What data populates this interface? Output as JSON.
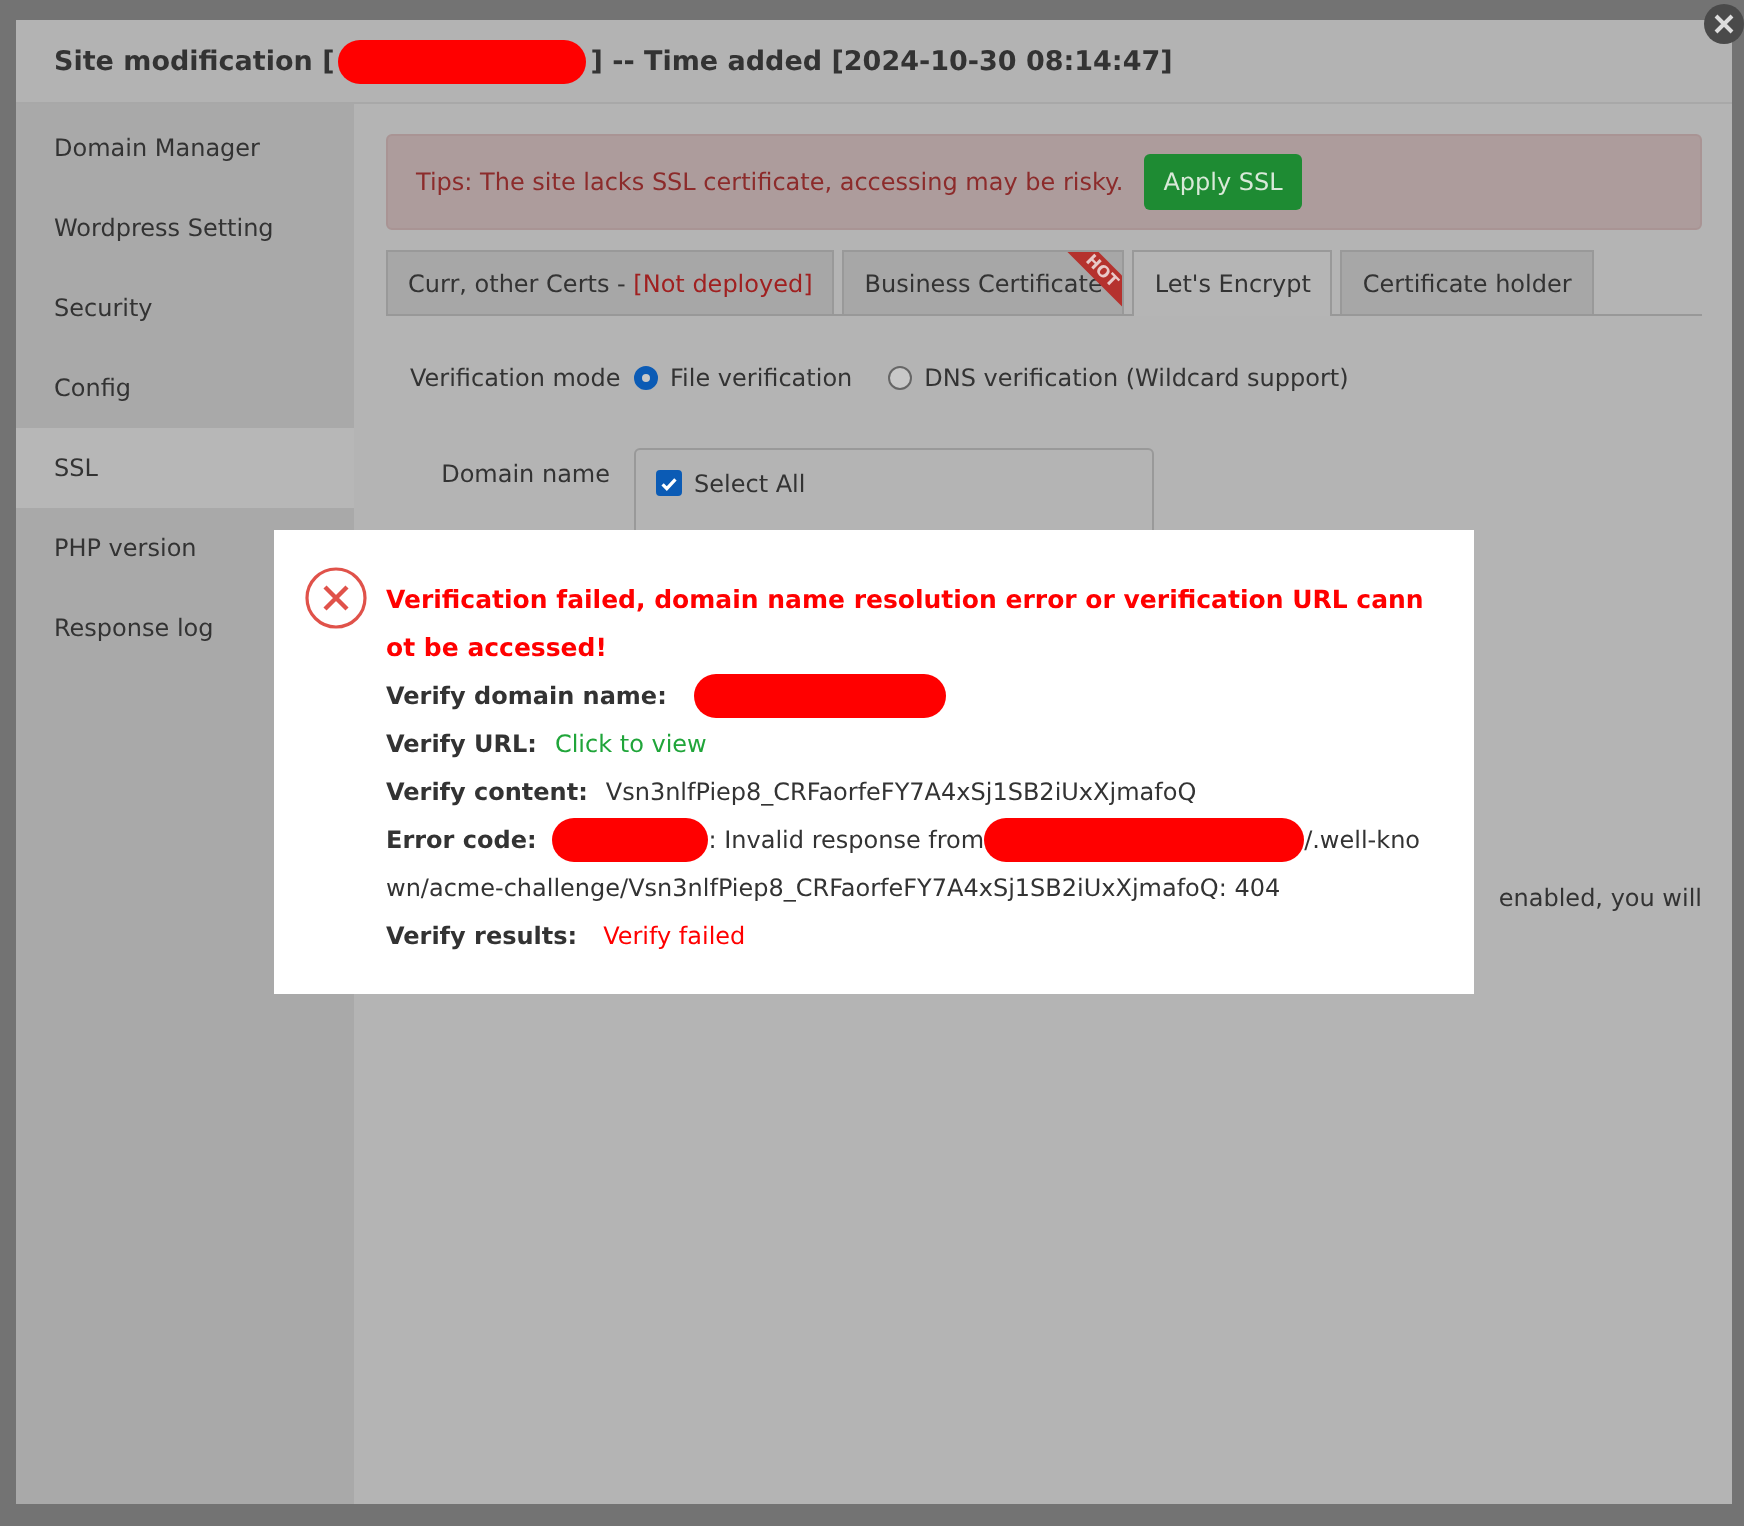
{
  "dialog": {
    "title_prefix": "Site modification [",
    "title_suffix": "] -- Time added [2024-10-30 08:14:47]"
  },
  "sidebar": {
    "items": [
      {
        "label": "Domain Manager",
        "selected": false
      },
      {
        "label": "Wordpress Setting",
        "selected": false
      },
      {
        "label": "Security",
        "selected": false
      },
      {
        "label": "Config",
        "selected": false
      },
      {
        "label": "SSL",
        "selected": true
      },
      {
        "label": "PHP version",
        "selected": false
      },
      {
        "label": "Response log",
        "selected": false
      }
    ]
  },
  "tip": {
    "text": "Tips: The site lacks SSL certificate, accessing may be risky.",
    "button": "Apply SSL"
  },
  "tabs": [
    {
      "label": "Curr, other Certs - ",
      "status": "[Not deployed]",
      "selected": false
    },
    {
      "label": "Business Certificate",
      "badge": "HOT",
      "selected": false
    },
    {
      "label": "Let's Encrypt",
      "selected": true
    },
    {
      "label": "Certificate holder",
      "selected": false
    }
  ],
  "verification_mode": {
    "label": "Verification mode",
    "options": [
      {
        "label": "File verification",
        "selected": true
      },
      {
        "label": "DNS verification (Wildcard support)",
        "selected": false
      }
    ]
  },
  "domain": {
    "label": "Domain name",
    "select_all": {
      "label": "Select All",
      "checked": true
    }
  },
  "note_fragment": "enabled, you will",
  "error_popup": {
    "title": "Verification failed, domain name resolution error or verification URL cannot be accessed!",
    "rows": [
      {
        "kind": "redacted",
        "label": "Verify domain name:"
      },
      {
        "kind": "link",
        "label": "Verify URL:",
        "value": "Click to view"
      },
      {
        "kind": "plain",
        "label": "Verify content:",
        "value": "Vsn3nlfPiep8_CRFaorfeFY7A4xSj1SB2iUxXjmafoQ"
      },
      {
        "kind": "error",
        "label": "Error code:",
        "value": ": Invalid response from",
        "tail": [
          "/.well-kno",
          "wn/acme-challenge/Vsn3nlfPiep8_CRFaorfeFY7A4xSj1SB2iUxXjmafoQ: 404"
        ]
      },
      {
        "kind": "failed",
        "label": "Verify results:",
        "value": "Verify failed"
      }
    ]
  }
}
